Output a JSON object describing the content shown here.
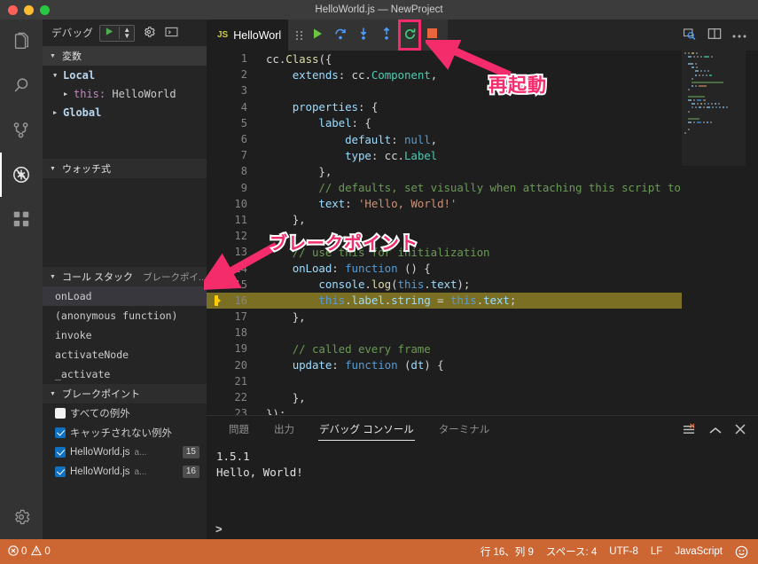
{
  "window": {
    "title": "HelloWorld.js — NewProject",
    "traffic_lights": [
      "close-red",
      "minimize-yellow",
      "maximize-green"
    ]
  },
  "activity_bar": {
    "items": [
      {
        "name": "explorer",
        "icon": "files-icon",
        "active": false
      },
      {
        "name": "search",
        "icon": "search-icon",
        "active": false
      },
      {
        "name": "source-control",
        "icon": "source-control-icon",
        "active": false
      },
      {
        "name": "debug",
        "icon": "debug-icon",
        "active": true
      },
      {
        "name": "extensions",
        "icon": "extensions-icon",
        "active": false
      }
    ],
    "settings_icon": "gear-icon"
  },
  "sidebar": {
    "header": {
      "title": "デバッグ",
      "run_icon": "play-icon",
      "config_select_icon": "chevron-updown-icon",
      "settings_icon": "gear-icon",
      "console_icon": "open-debug-console-icon"
    },
    "variables": {
      "title": "変数",
      "rows": [
        {
          "label": "Local",
          "kind": "scope",
          "expanded": true
        },
        {
          "label": "this:",
          "value": "HelloWorld",
          "kind": "variable",
          "expanded": false
        },
        {
          "label": "Global",
          "kind": "scope",
          "expanded": false
        }
      ]
    },
    "watch": {
      "title": "ウォッチ式",
      "items": []
    },
    "call_stack": {
      "title": "コール スタック",
      "secondary_title": "ブレークポイ..",
      "frames": [
        {
          "label": "onLoad",
          "selected": true
        },
        {
          "label": "(anonymous function)",
          "selected": false
        },
        {
          "label": "invoke",
          "selected": false
        },
        {
          "label": "activateNode",
          "selected": false
        },
        {
          "label": "_activate",
          "selected": false
        }
      ]
    },
    "breakpoints": {
      "title": "ブレークポイント",
      "items": [
        {
          "checked": false,
          "label": "すべての例外",
          "path": "",
          "line": ""
        },
        {
          "checked": true,
          "label": "キャッチされない例外",
          "path": "",
          "line": ""
        },
        {
          "checked": true,
          "label": "HelloWorld.js",
          "path": "a...",
          "line": "15"
        },
        {
          "checked": true,
          "label": "HelloWorld.js",
          "path": "a...",
          "line": "16"
        }
      ]
    }
  },
  "editor": {
    "tab": {
      "label": "HelloWorl",
      "icon": "js-file-icon"
    },
    "actions": [
      {
        "name": "open-preview-icon"
      },
      {
        "name": "split-editor-icon"
      },
      {
        "name": "more-actions-icon"
      }
    ],
    "debug_toolbar": {
      "grip": "drag-handle-icon",
      "buttons": [
        {
          "name": "continue",
          "icon": "play-icon",
          "color": "#6cc644",
          "highlighted": false
        },
        {
          "name": "step-over",
          "icon": "step-over-icon",
          "color": "#4a9eff",
          "highlighted": false
        },
        {
          "name": "step-into",
          "icon": "step-into-icon",
          "color": "#4a9eff",
          "highlighted": false
        },
        {
          "name": "step-out",
          "icon": "step-out-icon",
          "color": "#4a9eff",
          "highlighted": false
        },
        {
          "name": "restart",
          "icon": "restart-icon",
          "color": "#3fd17a",
          "highlighted": true
        },
        {
          "name": "stop",
          "icon": "stop-icon",
          "color": "#e8663c",
          "highlighted": false
        }
      ]
    },
    "lines": [
      {
        "n": 1,
        "indent": 0,
        "tokens": [
          [
            "c-pl",
            "cc"
          ],
          [
            "c-pun",
            "."
          ],
          [
            "c-fn",
            "Class"
          ],
          [
            "c-pun",
            "({"
          ]
        ]
      },
      {
        "n": 2,
        "indent": 1,
        "tokens": [
          [
            "c-prop",
            "extends"
          ],
          [
            "c-pun",
            ": "
          ],
          [
            "c-pl",
            "cc"
          ],
          [
            "c-pun",
            "."
          ],
          [
            "c-cls",
            "Component"
          ],
          [
            "c-pun",
            ","
          ]
        ]
      },
      {
        "n": 3,
        "indent": 0,
        "tokens": []
      },
      {
        "n": 4,
        "indent": 1,
        "tokens": [
          [
            "c-prop",
            "properties"
          ],
          [
            "c-pun",
            ": {"
          ]
        ]
      },
      {
        "n": 5,
        "indent": 2,
        "tokens": [
          [
            "c-prop",
            "label"
          ],
          [
            "c-pun",
            ": {"
          ]
        ]
      },
      {
        "n": 6,
        "indent": 3,
        "tokens": [
          [
            "c-prop",
            "default"
          ],
          [
            "c-pun",
            ": "
          ],
          [
            "c-kw",
            "null"
          ],
          [
            "c-pun",
            ","
          ]
        ]
      },
      {
        "n": 7,
        "indent": 3,
        "tokens": [
          [
            "c-prop",
            "type"
          ],
          [
            "c-pun",
            ": "
          ],
          [
            "c-pl",
            "cc"
          ],
          [
            "c-pun",
            "."
          ],
          [
            "c-cls",
            "Label"
          ]
        ]
      },
      {
        "n": 8,
        "indent": 2,
        "tokens": [
          [
            "c-pun",
            "},"
          ]
        ]
      },
      {
        "n": 9,
        "indent": 2,
        "tokens": [
          [
            "c-com",
            "// defaults, set visually when attaching this script to th"
          ]
        ]
      },
      {
        "n": 10,
        "indent": 2,
        "tokens": [
          [
            "c-prop",
            "text"
          ],
          [
            "c-pun",
            ": "
          ],
          [
            "c-str",
            "'Hello, World!'"
          ]
        ]
      },
      {
        "n": 11,
        "indent": 1,
        "tokens": [
          [
            "c-pun",
            "},"
          ]
        ]
      },
      {
        "n": 12,
        "indent": 0,
        "tokens": []
      },
      {
        "n": 13,
        "indent": 1,
        "tokens": [
          [
            "c-com",
            "// use this for initialization"
          ]
        ]
      },
      {
        "n": 14,
        "indent": 1,
        "tokens": [
          [
            "c-prop",
            "onLoad"
          ],
          [
            "c-pun",
            ": "
          ],
          [
            "c-kw",
            "function"
          ],
          [
            "c-pun",
            " () {"
          ]
        ]
      },
      {
        "n": 15,
        "indent": 2,
        "tokens": [
          [
            "c-prop",
            "console"
          ],
          [
            "c-pun",
            "."
          ],
          [
            "c-fn",
            "log"
          ],
          [
            "c-pun",
            "("
          ],
          [
            "c-this",
            "this"
          ],
          [
            "c-pun",
            "."
          ],
          [
            "c-prop",
            "text"
          ],
          [
            "c-pun",
            ");"
          ]
        ],
        "breakpoint": true
      },
      {
        "n": 16,
        "indent": 2,
        "tokens": [
          [
            "c-this",
            "this"
          ],
          [
            "c-pun",
            "."
          ],
          [
            "c-prop",
            "label"
          ],
          [
            "c-pun",
            "."
          ],
          [
            "c-prop",
            "string"
          ],
          [
            "c-pun",
            " = "
          ],
          [
            "c-this",
            "this"
          ],
          [
            "c-pun",
            "."
          ],
          [
            "c-prop",
            "text"
          ],
          [
            "c-pun",
            ";"
          ]
        ],
        "current": true,
        "highlight": true
      },
      {
        "n": 17,
        "indent": 1,
        "tokens": [
          [
            "c-pun",
            "},"
          ]
        ]
      },
      {
        "n": 18,
        "indent": 0,
        "tokens": []
      },
      {
        "n": 19,
        "indent": 1,
        "tokens": [
          [
            "c-com",
            "// called every frame"
          ]
        ]
      },
      {
        "n": 20,
        "indent": 1,
        "tokens": [
          [
            "c-prop",
            "update"
          ],
          [
            "c-pun",
            ": "
          ],
          [
            "c-kw",
            "function"
          ],
          [
            "c-pun",
            " ("
          ],
          [
            "c-def",
            "dt"
          ],
          [
            "c-pun",
            ") {"
          ]
        ]
      },
      {
        "n": 21,
        "indent": 0,
        "tokens": []
      },
      {
        "n": 22,
        "indent": 1,
        "tokens": [
          [
            "c-pun",
            "},"
          ]
        ]
      },
      {
        "n": 23,
        "indent": 0,
        "tokens": [
          [
            "c-pun",
            "});"
          ]
        ]
      }
    ]
  },
  "panel": {
    "tabs": [
      {
        "label": "問題",
        "active": false
      },
      {
        "label": "出力",
        "active": false
      },
      {
        "label": "デバッグ コンソール",
        "active": true
      },
      {
        "label": "ターミナル",
        "active": false
      }
    ],
    "actions": [
      {
        "name": "clear-console-icon"
      },
      {
        "name": "maximize-panel-icon"
      },
      {
        "name": "close-panel-icon"
      }
    ],
    "console_lines": [
      "1.5.1",
      "Hello, World!"
    ],
    "input_prompt": ">",
    "input_value": ""
  },
  "status_bar": {
    "errors": "0",
    "warnings": "0",
    "right_items": [
      {
        "name": "cursor-position",
        "label": "行 16、列 9"
      },
      {
        "name": "indentation",
        "label": "スペース: 4"
      },
      {
        "name": "encoding",
        "label": "UTF-8"
      },
      {
        "name": "eol",
        "label": "LF"
      },
      {
        "name": "language-mode",
        "label": "JavaScript"
      },
      {
        "name": "feedback-smiley",
        "label": "☺"
      }
    ],
    "background_color": "#cc6633"
  },
  "annotations": [
    {
      "name": "restart-annotation",
      "text": "再起動",
      "color": "#f42c6b"
    },
    {
      "name": "breakpoint-annotation",
      "text": "ブレークポイント",
      "color": "#f42c6b"
    }
  ]
}
